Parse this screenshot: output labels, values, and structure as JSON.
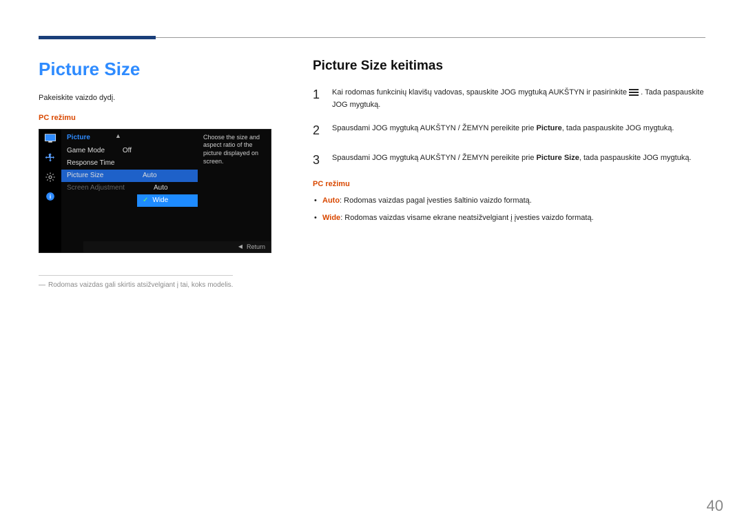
{
  "page_number": "40",
  "left": {
    "title": "Picture Size",
    "intro": "Pakeiskite vaizdo dydį.",
    "pc_mode_label": "PC režimu",
    "footnote": "Rodomas vaizdas gali skirtis atsižvelgiant į tai, koks modelis."
  },
  "osd": {
    "section_title": "Picture",
    "rows": [
      {
        "label": "Game Mode",
        "value": "Off"
      },
      {
        "label": "Response Time",
        "value": ""
      },
      {
        "label": "Picture Size",
        "value": "Auto"
      },
      {
        "label": "Screen Adjustment",
        "value": ""
      }
    ],
    "options": [
      {
        "label": "Auto",
        "checked": false
      },
      {
        "label": "Wide",
        "checked": true
      }
    ],
    "description": "Choose the size and aspect ratio of the picture displayed on screen.",
    "return_label": "Return"
  },
  "right": {
    "title": "Picture Size keitimas",
    "steps": [
      {
        "num": "1",
        "before": "Kai rodomas funkcinių klavišų vadovas, spauskite JOG mygtuką AUKŠTYN ir pasirinkite ",
        "after_icon": ". Tada paspauskite JOG mygtuką."
      },
      {
        "num": "2",
        "pre": "Spausdami JOG mygtuką AUKŠTYN / ŽEMYN pereikite prie ",
        "hl": "Picture",
        "post": ", tada paspauskite JOG mygtuką."
      },
      {
        "num": "3",
        "pre": "Spausdami JOG mygtuką AUKŠTYN / ŽEMYN pereikite prie ",
        "hl": "Picture Size",
        "post": ", tada paspauskite JOG mygtuką."
      }
    ],
    "pc_mode_label": "PC režimu",
    "bullets": [
      {
        "hl": "Auto",
        "text": ": Rodomas vaizdas pagal įvesties šaltinio vaizdo formatą."
      },
      {
        "hl": "Wide",
        "text": ": Rodomas vaizdas visame ekrane neatsižvelgiant į įvesties vaizdo formatą."
      }
    ]
  }
}
